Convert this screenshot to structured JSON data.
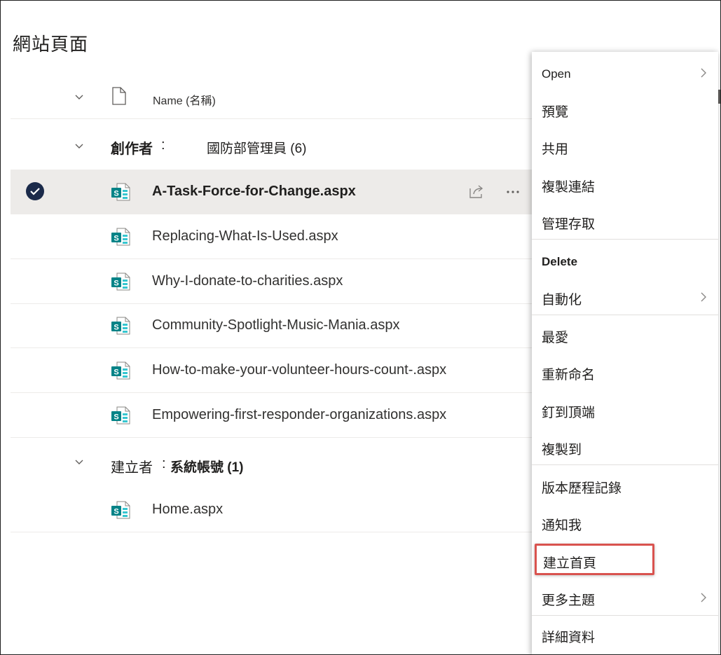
{
  "page": {
    "title": "網站頁面"
  },
  "column_header": {
    "name_label": "Name (名稱)"
  },
  "groups": [
    {
      "label": "創作者",
      "separator": ":",
      "value": "國防部管理員 (6)",
      "files": [
        {
          "name": "A-Task-Force-for-Change.aspx",
          "selected": true
        },
        {
          "name": "Replacing-What-Is-Used.aspx",
          "selected": false
        },
        {
          "name": "Why-I-donate-to-charities.aspx",
          "selected": false
        },
        {
          "name": "Community-Spotlight-Music-Mania.aspx",
          "selected": false
        },
        {
          "name": "How-to-make-your-volunteer-hours-count-.aspx",
          "selected": false
        },
        {
          "name": "Empowering-first-responder-organizations.aspx",
          "selected": false
        }
      ]
    },
    {
      "label": "建立者",
      "separator": ":",
      "value": "系統帳號 (1)",
      "files": [
        {
          "name": "Home.aspx",
          "selected": false
        }
      ]
    }
  ],
  "context_menu": {
    "items": [
      {
        "label": "Open",
        "has_submenu": true
      },
      {
        "label": "預覽",
        "has_submenu": false
      },
      {
        "label": "共用",
        "has_submenu": false
      },
      {
        "label": "複製連結",
        "has_submenu": false
      },
      {
        "label": "管理存取",
        "has_submenu": false
      },
      {
        "label": "Delete",
        "has_submenu": false
      },
      {
        "label": "自動化",
        "has_submenu": true
      },
      {
        "label": "最愛",
        "has_submenu": false
      },
      {
        "label": "重新命名",
        "has_submenu": false
      },
      {
        "label": "釘到頂端",
        "has_submenu": false
      },
      {
        "label": "複製到",
        "has_submenu": false
      },
      {
        "label": "版本歷程記錄",
        "has_submenu": false
      },
      {
        "label": "通知我",
        "has_submenu": false
      },
      {
        "label": "建立首頁",
        "has_submenu": false,
        "highlighted": true
      },
      {
        "label": "更多主題",
        "has_submenu": true
      },
      {
        "label": "詳細資料",
        "has_submenu": false
      }
    ]
  },
  "colors": {
    "sharepoint_teal": "#038387",
    "sharepoint_teal_light": "#37c6d0",
    "check_navy": "#1b2a4a",
    "selected_bg": "#edebe9",
    "highlight_red": "#d9534f"
  }
}
